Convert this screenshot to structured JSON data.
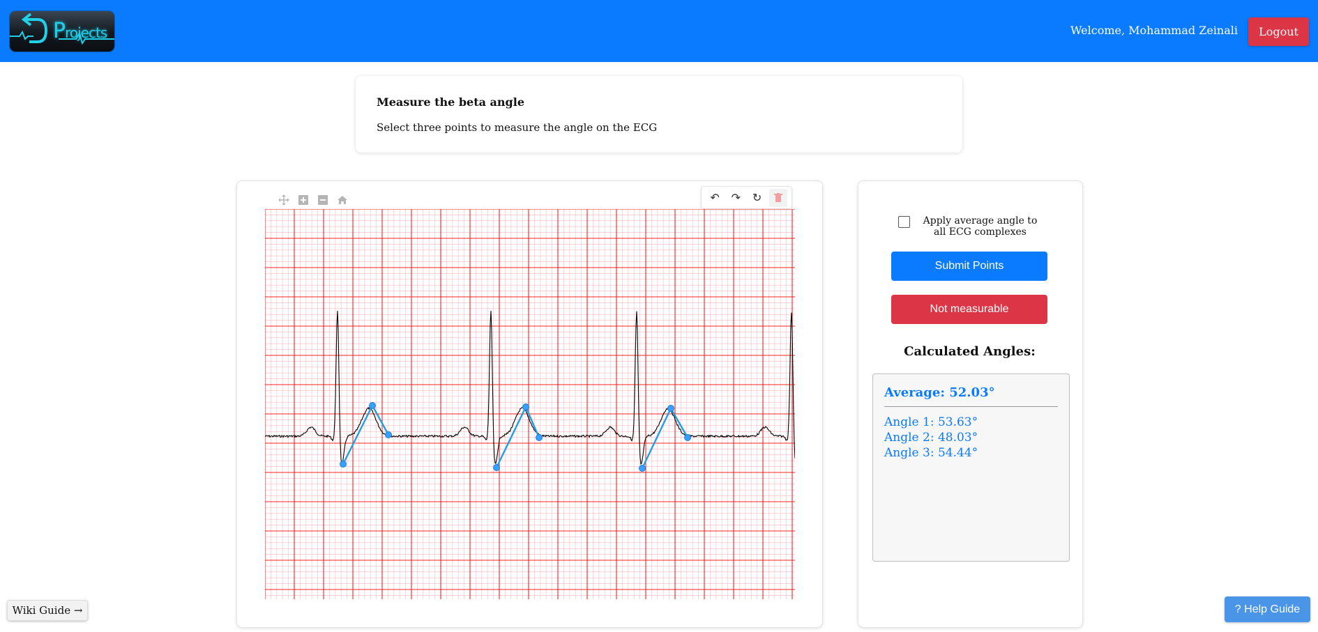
{
  "header": {
    "logo_text_big": "P",
    "logo_text_small": "rojects",
    "welcome": "Welcome, Mohammad Zeinali",
    "logout_label": "Logout",
    "bg_color": "#0a7bff"
  },
  "instructions": {
    "title": "Measure the beta angle",
    "description": "Select three points to measure the angle on the ECG"
  },
  "plot_toolbar": {
    "icons": [
      "pan-icon",
      "zoom-in-icon",
      "zoom-out-icon",
      "home-icon"
    ]
  },
  "edit_toolbar": {
    "icons": [
      "undo-icon",
      "redo-icon",
      "reset-icon",
      "trash-icon"
    ]
  },
  "side_panel": {
    "apply_checkbox_label": "Apply average angle to all ECG complexes",
    "apply_checked": false,
    "submit_label": "Submit Points",
    "not_measurable_label": "Not measurable",
    "calc_title": "Calculated Angles:",
    "average": "Average: 52.03°",
    "angles": [
      "Angle 1: 53.63°",
      "Angle 2: 48.03°",
      "Angle 3: 54.44°"
    ]
  },
  "footer": {
    "wiki_label": "Wiki Guide →",
    "help_label": "? Help Guide"
  },
  "colors": {
    "primary": "#0a7bff",
    "danger": "#dc3545",
    "grid_major": "#ff2020",
    "grid_minor": "#ffb8c0",
    "trace": "#000000",
    "annotation": "#1ea0e6"
  }
}
